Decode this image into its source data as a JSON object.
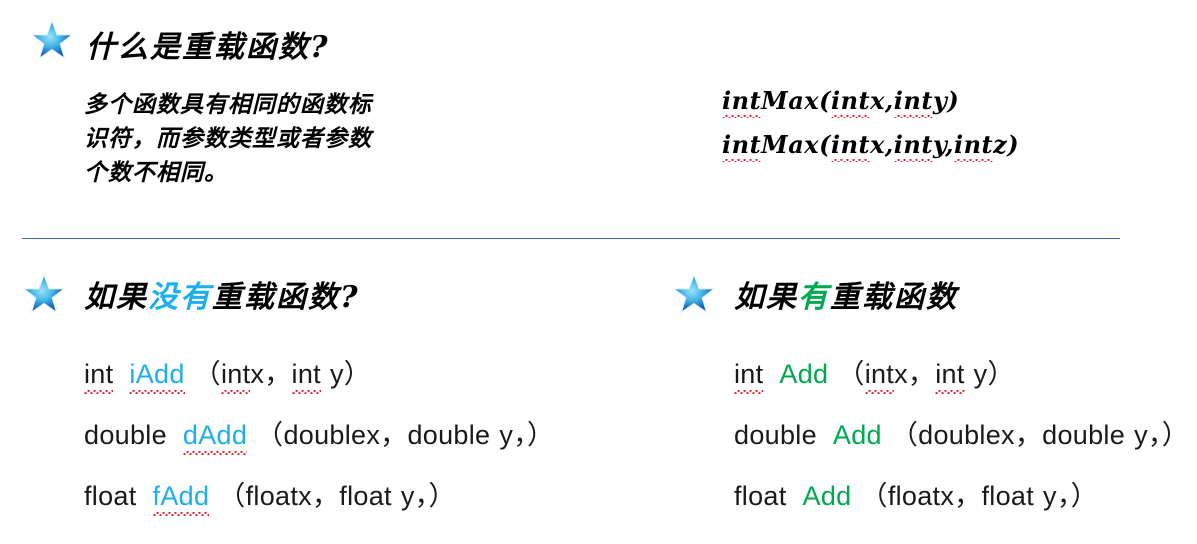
{
  "slide": {
    "background_color": "#FFFFFF",
    "divider_color": "#3B6EA8",
    "accent_cyan": "#1CAFEC",
    "accent_green": "#00A94F",
    "spellcheck_underline_color": "#E8202A",
    "star_bullet_icon": "star-icon"
  },
  "section_top": {
    "heading": "什么是重载函数?",
    "body": "多个函数具有相同的函数标\n识符，而参数类型或者参数\n个数不相同。",
    "code": {
      "line1": {
        "t1": "int",
        "t2": "Max",
        "t3": "(",
        "t4": "int",
        "t5": "x,",
        "t6": "int",
        "t7": "y",
        "t8": ")"
      },
      "line2": {
        "t1": "int",
        "t2": "Max",
        "t3": "(",
        "t4": "int",
        "t5": "x,",
        "t6": "int",
        "t7": "y",
        "t8": ",",
        "t9": "int",
        "t10": "z",
        "t11": ")"
      }
    }
  },
  "section_left": {
    "heading_part1": "如果",
    "heading_accent": "没有",
    "heading_part2": "重载函数?",
    "heading_accent_color": "#1CAFEC",
    "lines": [
      {
        "ret": "int",
        "ret_underlined": true,
        "name": "iAdd",
        "name_underlined": true,
        "open": "（",
        "p1_type": "int",
        "p1_type_underlined": true,
        "p1_name": "x",
        "comma": "，",
        "p2_type": "int",
        "p2_type_underlined": true,
        "p2_name": "y",
        "trail": "",
        "close": "）"
      },
      {
        "ret": "double",
        "ret_underlined": false,
        "name": "dAdd",
        "name_underlined": true,
        "open": "（",
        "p1_type": "double",
        "p1_type_underlined": false,
        "p1_name": "x",
        "comma": "，",
        "p2_type": "double",
        "p2_type_underlined": false,
        "p2_name": "y",
        "trail": "，",
        "close": "）"
      },
      {
        "ret": "float",
        "ret_underlined": false,
        "name": "fAdd",
        "name_underlined": true,
        "open": "（",
        "p1_type": "float",
        "p1_type_underlined": false,
        "p1_name": "x",
        "comma": "，",
        "p2_type": "float",
        "p2_type_underlined": false,
        "p2_name": "y",
        "trail": "，",
        "close": "）"
      }
    ]
  },
  "section_right": {
    "heading_part1": "如果",
    "heading_accent": "有",
    "heading_part2": "重载函数",
    "heading_accent_color": "#00A94F",
    "lines": [
      {
        "ret": "int",
        "ret_underlined": true,
        "name": "Add",
        "name_underlined": false,
        "open": "（",
        "p1_type": "int",
        "p1_type_underlined": true,
        "p1_name": "x",
        "comma": "，",
        "p2_type": "int",
        "p2_type_underlined": true,
        "p2_name": "y",
        "trail": "",
        "close": "）"
      },
      {
        "ret": "double",
        "ret_underlined": false,
        "name": "Add",
        "name_underlined": false,
        "open": "（",
        "p1_type": "double",
        "p1_type_underlined": false,
        "p1_name": "x",
        "comma": "，",
        "p2_type": "double",
        "p2_type_underlined": false,
        "p2_name": "y",
        "trail": "，",
        "close": "）"
      },
      {
        "ret": "float",
        "ret_underlined": false,
        "name": "Add",
        "name_underlined": false,
        "open": "（",
        "p1_type": "float",
        "p1_type_underlined": false,
        "p1_name": "x",
        "comma": "，",
        "p2_type": "float",
        "p2_type_underlined": false,
        "p2_name": "y",
        "trail": "，",
        "close": "）"
      }
    ]
  }
}
